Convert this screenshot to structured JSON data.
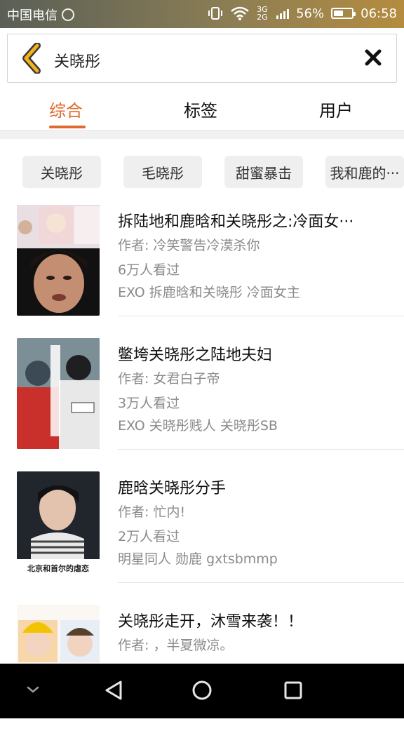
{
  "status_bar": {
    "carrier": "中国电信",
    "network": "3G 2G",
    "battery_pct": "56%",
    "battery_fraction": 0.56,
    "time": "06:58",
    "icons": [
      "hotspot-icon",
      "vibrate-icon",
      "wifi-icon",
      "signal-icon",
      "battery-icon"
    ]
  },
  "search": {
    "query": "关晓彤",
    "back_icon": "chevron-left-icon",
    "clear_icon": "close-icon",
    "accent_color": "#e06b2f"
  },
  "tabs": [
    {
      "label": "综合",
      "active": true
    },
    {
      "label": "标签",
      "active": false
    },
    {
      "label": "用户",
      "active": false
    }
  ],
  "tag_chips": [
    "关晓彤",
    "毛晓彤",
    "甜蜜暴击",
    "我和鹿的···"
  ],
  "results": [
    {
      "title": "拆陆地和鹿晗和关晓彤之:冷面女···",
      "author": "作者: 冷笑警告冷漠杀你",
      "views": "6万人看过",
      "tags": "EXO  拆鹿晗和关晓彤  冷面女主"
    },
    {
      "title": "鳖垮关晓彤之陆地夫妇",
      "author": "作者: 女君白子帝",
      "views": "3万人看过",
      "tags": "EXO  关晓彤贱人  关晓彤SB"
    },
    {
      "title": "鹿晗关晓彤分手",
      "author": "作者: 忙内!",
      "views": "2万人看过",
      "tags": "明星同人  勋鹿  gxtsbmmp",
      "cover_caption": "北京和首尔的虐恋"
    },
    {
      "title": "关晓彤走开，沐雪来袭！！",
      "author": "作者: ，半夏微凉。",
      "views": ""
    }
  ],
  "nav_bar": {
    "icons": [
      "chevron-down-icon",
      "back-triangle-icon",
      "home-circle-icon",
      "recents-square-icon"
    ]
  }
}
